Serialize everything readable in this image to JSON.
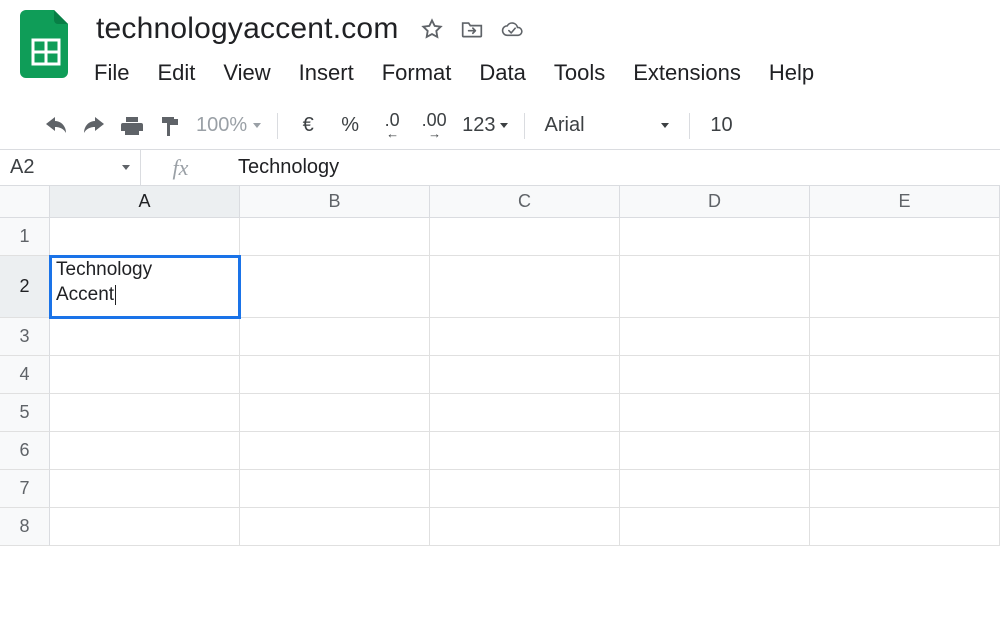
{
  "doc": {
    "title": "technologyaccent.com"
  },
  "menu": {
    "file": "File",
    "edit": "Edit",
    "view": "View",
    "insert": "Insert",
    "format": "Format",
    "data": "Data",
    "tools": "Tools",
    "extensions": "Extensions",
    "help": "Help"
  },
  "toolbar": {
    "zoom": "100%",
    "currency": "€",
    "percent": "%",
    "dec_decrease": ".0",
    "dec_increase": ".00",
    "more_formats": "123",
    "font": "Arial",
    "font_size": "10"
  },
  "formula_bar": {
    "cell_ref": "A2",
    "fx_label": "fx",
    "value": "Technology"
  },
  "columns": [
    "A",
    "B",
    "C",
    "D",
    "E"
  ],
  "rows": [
    "1",
    "2",
    "3",
    "4",
    "5",
    "6",
    "7",
    "8"
  ],
  "active_cell": {
    "row": 1,
    "col": 0,
    "content": "Technology\nAccent"
  }
}
